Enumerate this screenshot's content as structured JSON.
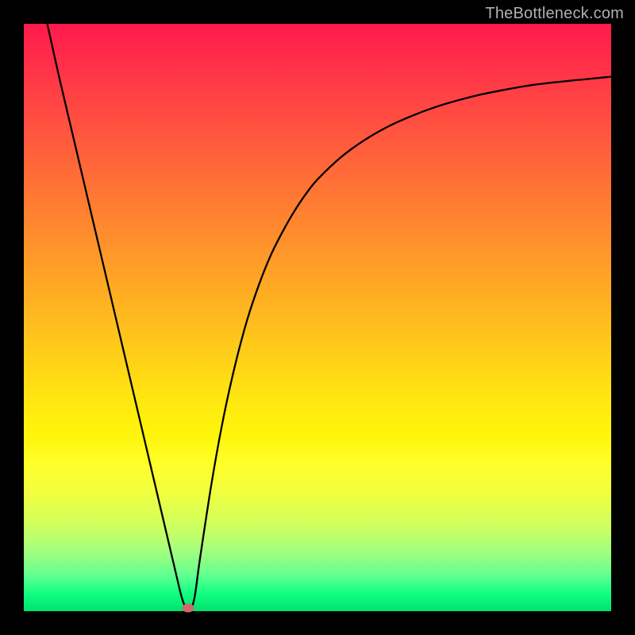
{
  "watermark": "TheBottleneck.com",
  "chart_data": {
    "type": "line",
    "title": "",
    "xlabel": "",
    "ylabel": "",
    "xlim": [
      0,
      100
    ],
    "ylim": [
      0,
      100
    ],
    "grid": false,
    "legend": false,
    "series": [
      {
        "name": "bottleneck-curve",
        "x": [
          4,
          6,
          8,
          10,
          12,
          14,
          16,
          18,
          20,
          22,
          24,
          26,
          27,
          28,
          29,
          30,
          32,
          34,
          36,
          38,
          40,
          42,
          44,
          46,
          48,
          50,
          54,
          58,
          62,
          66,
          70,
          74,
          78,
          82,
          86,
          90,
          94,
          98,
          100
        ],
        "y": [
          100,
          91,
          82.5,
          74,
          65.5,
          57,
          48.5,
          40,
          31.5,
          23,
          14.5,
          6,
          2,
          0,
          2,
          9,
          22,
          33,
          42,
          49.5,
          55.5,
          60.5,
          64.5,
          68,
          71,
          73.5,
          77.3,
          80.2,
          82.5,
          84.3,
          85.8,
          87,
          88,
          88.8,
          89.5,
          90,
          90.4,
          90.8,
          91
        ]
      }
    ],
    "annotations": [
      {
        "name": "minimum-marker",
        "x": 28,
        "y": 0
      }
    ],
    "background_gradient": {
      "top": "#ff1a4d",
      "mid": "#ffd015",
      "bottom": "#00e070"
    }
  }
}
